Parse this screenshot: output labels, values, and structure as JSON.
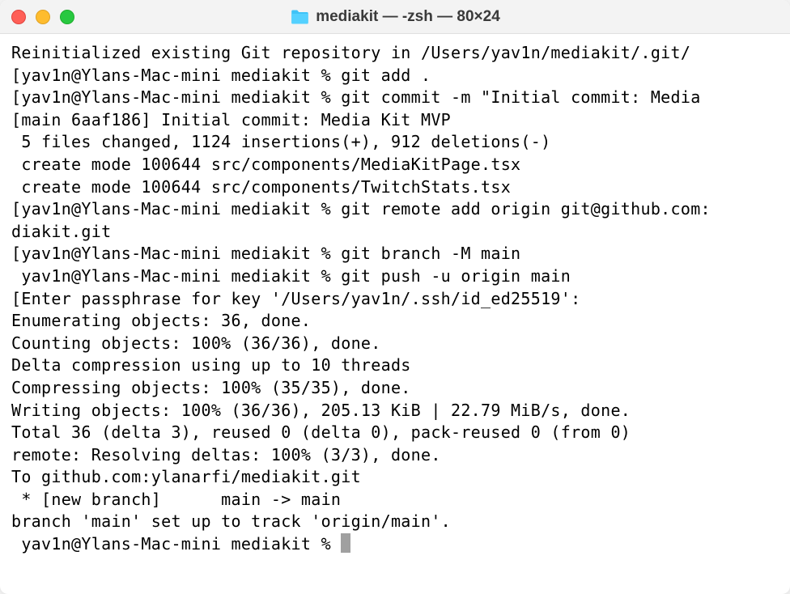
{
  "window": {
    "title": "mediakit — -zsh — 80×24"
  },
  "terminal": {
    "lines": [
      "Reinitialized existing Git repository in /Users/yav1n/mediakit/.git/",
      "[yav1n@Ylans-Mac-mini mediakit % git add .",
      "[yav1n@Ylans-Mac-mini mediakit % git commit -m \"Initial commit: Media",
      "[main 6aaf186] Initial commit: Media Kit MVP",
      " 5 files changed, 1124 insertions(+), 912 deletions(-)",
      " create mode 100644 src/components/MediaKitPage.tsx",
      " create mode 100644 src/components/TwitchStats.tsx",
      "[yav1n@Ylans-Mac-mini mediakit % git remote add origin git@github.com:",
      "diakit.git",
      "[yav1n@Ylans-Mac-mini mediakit % git branch -M main",
      " yav1n@Ylans-Mac-mini mediakit % git push -u origin main",
      "",
      "[Enter passphrase for key '/Users/yav1n/.ssh/id_ed25519':",
      "Enumerating objects: 36, done.",
      "Counting objects: 100% (36/36), done.",
      "Delta compression using up to 10 threads",
      "Compressing objects: 100% (35/35), done.",
      "Writing objects: 100% (36/36), 205.13 KiB | 22.79 MiB/s, done.",
      "Total 36 (delta 3), reused 0 (delta 0), pack-reused 0 (from 0)",
      "remote: Resolving deltas: 100% (3/3), done.",
      "To github.com:ylanarfi/mediakit.git",
      " * [new branch]      main -> main",
      "branch 'main' set up to track 'origin/main'."
    ],
    "prompt": " yav1n@Ylans-Mac-mini mediakit % "
  }
}
